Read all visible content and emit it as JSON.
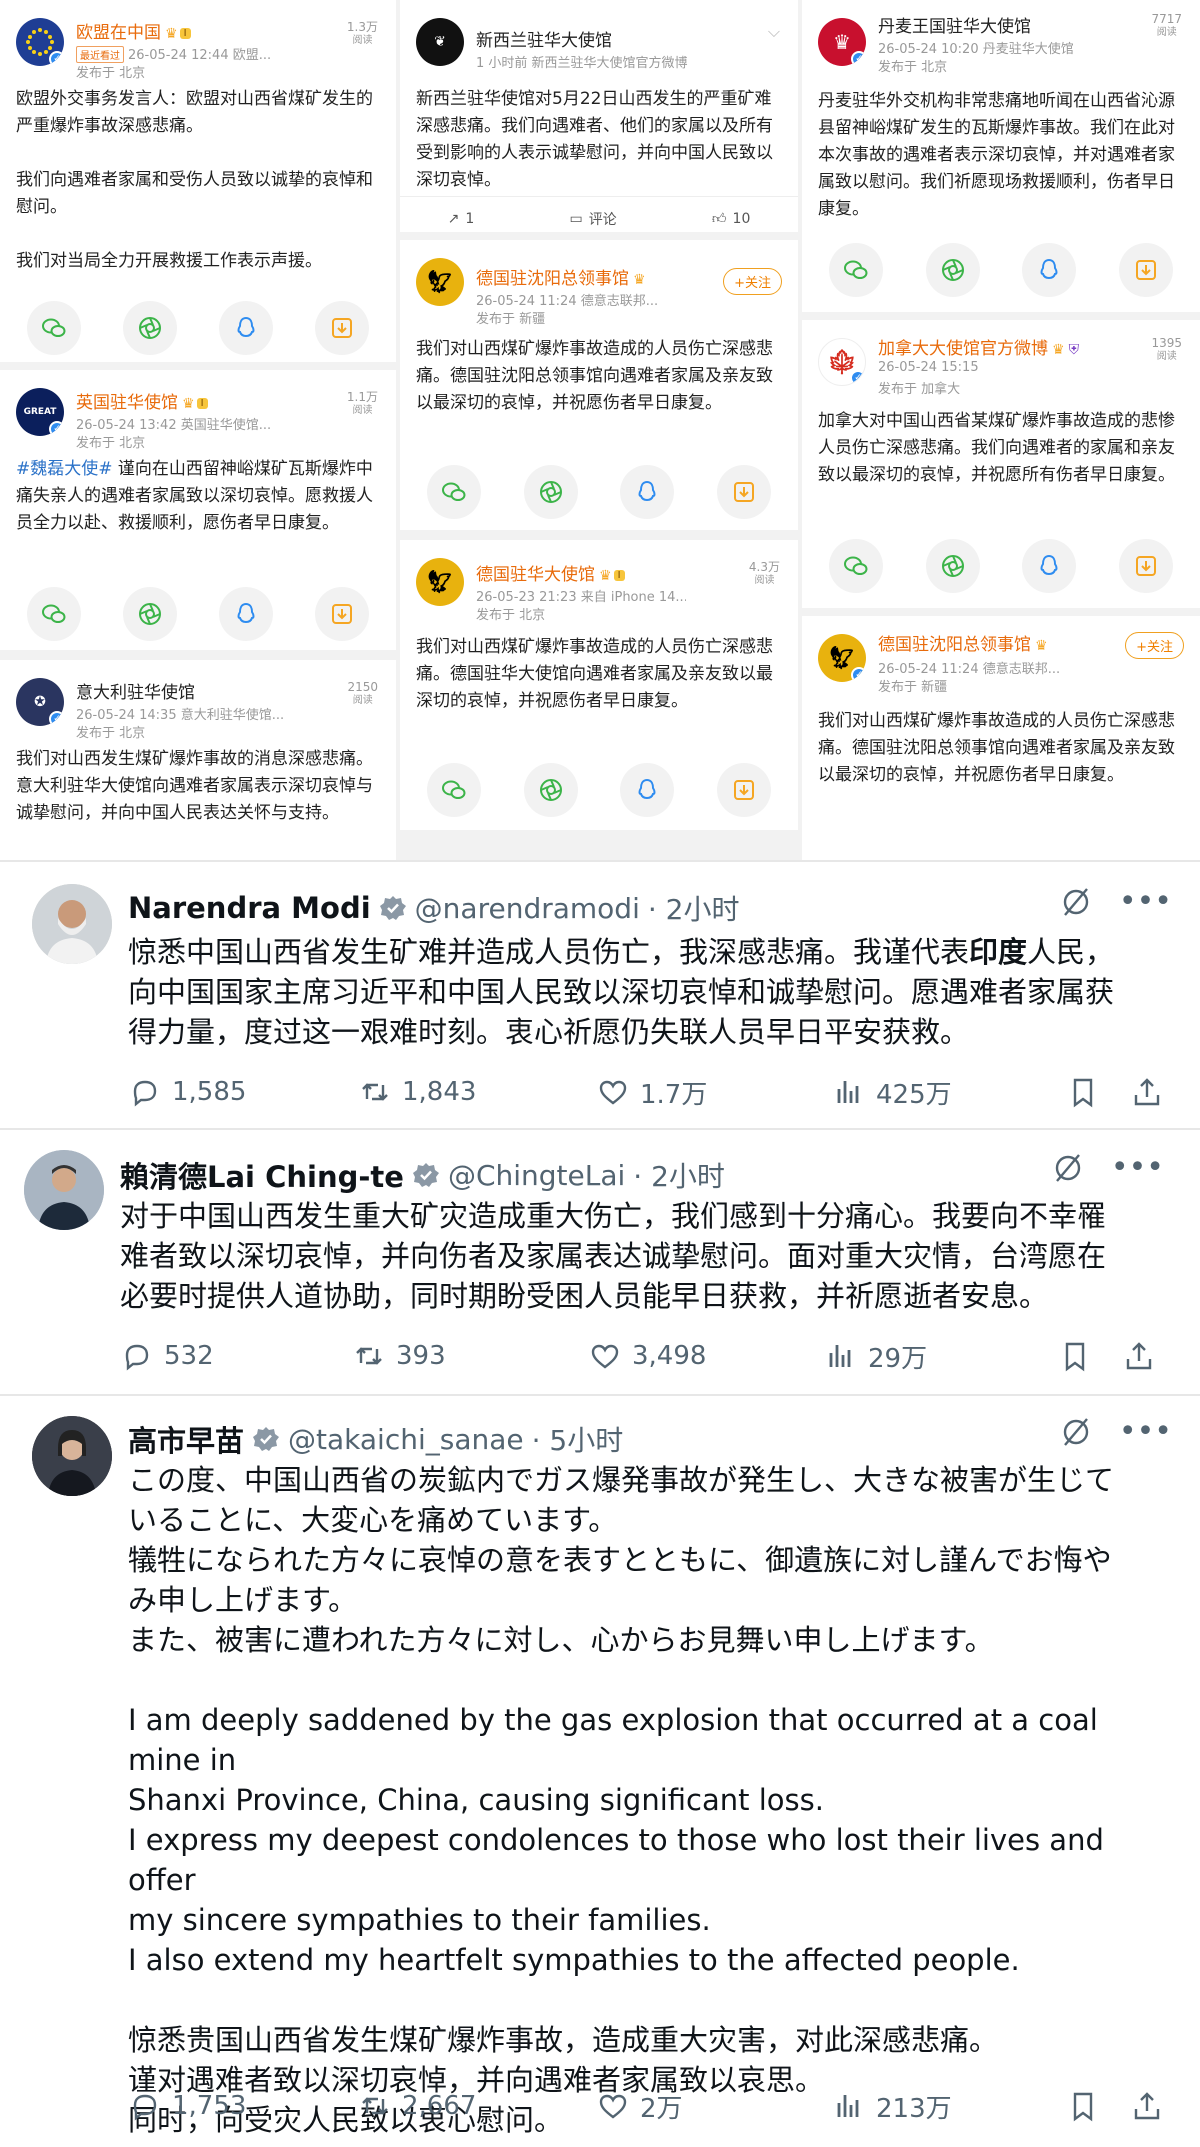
{
  "weibo": {
    "col1": [
      {
        "name": "欧盟在中国",
        "recent_tag": "最近看过",
        "meta": "26-05-24 12:44 欧盟...",
        "location": "发布于 北京",
        "views": "1.3万",
        "views_unit": "阅读",
        "paragraphs": [
          "欧盟外交事务发言人：欧盟对山西省煤矿发生的严重爆炸事故深感悲痛。",
          "我们向遇难者家属和受伤人员致以诚挚的哀悼和慰问。",
          "我们对当局全力开展救援工作表示声援。"
        ]
      },
      {
        "name": "英国驻华使馆",
        "meta": "26-05-24 13:42 英国驻华使馆...",
        "location": "发布于 北京",
        "views": "1.1万",
        "views_unit": "阅读",
        "hashtag": "#魏磊大使#",
        "text": " 谨向在山西留神峪煤矿瓦斯爆炸中痛失亲人的遇难者家属致以深切哀悼。愿救援人员全力以赴、救援顺利，愿伤者早日康复。"
      },
      {
        "name": "意大利驻华使馆",
        "meta": "26-05-24 14:35 意大利驻华使馆...",
        "location": "发布于 北京",
        "views": "2150",
        "views_unit": "阅读",
        "text": "我们对山西发生煤矿爆炸事故的消息深感悲痛。意大利驻华大使馆向遇难者家属表示深切哀悼与诚挚慰问，并向中国人民表达关怀与支持。"
      }
    ],
    "col2": [
      {
        "name": "新西兰驻华大使馆",
        "meta": "1 小时前 新西兰驻华大使馆官方微博",
        "text": "新西兰驻华使馆对5月22日山西发生的严重矿难深感悲痛。我们向遇难者、他们的家属以及所有受到影响的人表示诚挚慰问，并向中国人民致以深切哀悼。",
        "repost": "1",
        "comment": "评论",
        "like": "10"
      },
      {
        "name": "德国驻沈阳总领事馆",
        "meta": "26-05-24 11:24 德意志联邦...",
        "location": "发布于 新疆",
        "follow": "+关注",
        "text": "我们对山西煤矿爆炸事故造成的人员伤亡深感悲痛。德国驻沈阳总领事馆向遇难者家属及亲友致以最深切的哀悼，并祝愿伤者早日康复。"
      },
      {
        "name": "德国驻华大使馆",
        "meta": "26-05-23 21:23 来自 iPhone 14...",
        "location": "发布于 北京",
        "views": "4.3万",
        "views_unit": "阅读",
        "text": "我们对山西煤矿爆炸事故造成的人员伤亡深感悲痛。德国驻华大使馆向遇难者家属及亲友致以最深切的哀悼，并祝愿伤者早日康复。"
      }
    ],
    "col3": [
      {
        "name": "丹麦王国驻华大使馆",
        "meta": "26-05-24 10:20 丹麦驻华大使馆",
        "location": "发布于 北京",
        "views": "7717",
        "views_unit": "阅读",
        "text": "丹麦驻华外交机构非常悲痛地听闻在山西省沁源县留神峪煤矿发生的瓦斯爆炸事故。我们在此对本次事故的遇难者表示深切哀悼，并对遇难者家属致以慰问。我们祈愿现场救援顺利，伤者早日康复。"
      },
      {
        "name": "加拿大大使馆官方微博",
        "meta": "26-05-24 15:15",
        "location": "发布于 加拿大",
        "views": "1395",
        "views_unit": "阅读",
        "text": "加拿大对中国山西省某煤矿爆炸事故造成的悲惨人员伤亡深感悲痛。我们向遇难者的家属和亲友致以最深切的哀悼，并祝愿所有伤者早日康复。"
      },
      {
        "name": "德国驻沈阳总领事馆",
        "meta": "26-05-24 11:24 德意志联邦...",
        "location": "发布于 新疆",
        "follow": "+关注",
        "text": "我们对山西煤矿爆炸事故造成的人员伤亡深感悲痛。德国驻沈阳总领事馆向遇难者家属及亲友致以最深切的哀悼，并祝愿伤者早日康复。"
      }
    ]
  },
  "tweets": [
    {
      "name": "Narendra Modi",
      "handle": "@narendramodi",
      "time": "· 2小时",
      "line1a": "惊悉中国山西省发生矿难并造成人员伤亡，我深感悲痛。我谨代表",
      "line1b": "印度",
      "line1c": "人民，",
      "rest": "向中国国家主席习近平和中国人民致以深切哀悼和诚挚慰问。愿遇难者家属获\n得力量，度过这一艰难时刻。衷心祈愿仍失联人员早日平安获救。",
      "replies": "1,585",
      "retweets": "1,843",
      "likes": "1.7万",
      "views": "425万"
    },
    {
      "name": "賴清德Lai Ching-te",
      "handle": "@ChingteLai",
      "time": "· 2小时",
      "text": "对于中国山西发生重大矿灾造成重大伤亡，我们感到十分痛心。我要向不幸罹\n难者致以深切哀悼，并向伤者及家属表达诚挚慰问。面对重大灾情，台湾愿在\n必要时提供人道协助，同时期盼受困人员能早日获救，并祈愿逝者安息。",
      "replies": "532",
      "retweets": "393",
      "likes": "3,498",
      "views": "29万"
    },
    {
      "name": "高市早苗",
      "handle": "@takaichi_sanae",
      "time": "· 5小时",
      "text": "この度、中国山西省の炭鉱内でガス爆発事故が発生し、大きな被害が生じて\nいることに、大変心を痛めています。\n犠牲になられた方々に哀悼の意を表すとともに、御遺族に対し謹んでお悔や\nみ申し上げます。\nまた、被害に遭われた方々に対し、心からお見舞い申し上げます。\n\nI am deeply saddened by the gas explosion that occurred at a coal mine in\nShanxi Province, China, causing significant loss.\nI express my deepest condolences to those who lost their lives and offer\nmy sincere sympathies to their families.\nI also extend my heartfelt sympathies to the affected people.\n\n惊悉贵国山西省发生煤矿爆炸事故，造成重大灾害，对此深感悲痛。\n谨对遇难者致以深切哀悼，并向遇难者家属致以哀思。\n同时，向受灾人民致以衷心慰问。",
      "replies": "1,753",
      "retweets": "2,667",
      "likes": "2万",
      "views": "213万"
    }
  ]
}
